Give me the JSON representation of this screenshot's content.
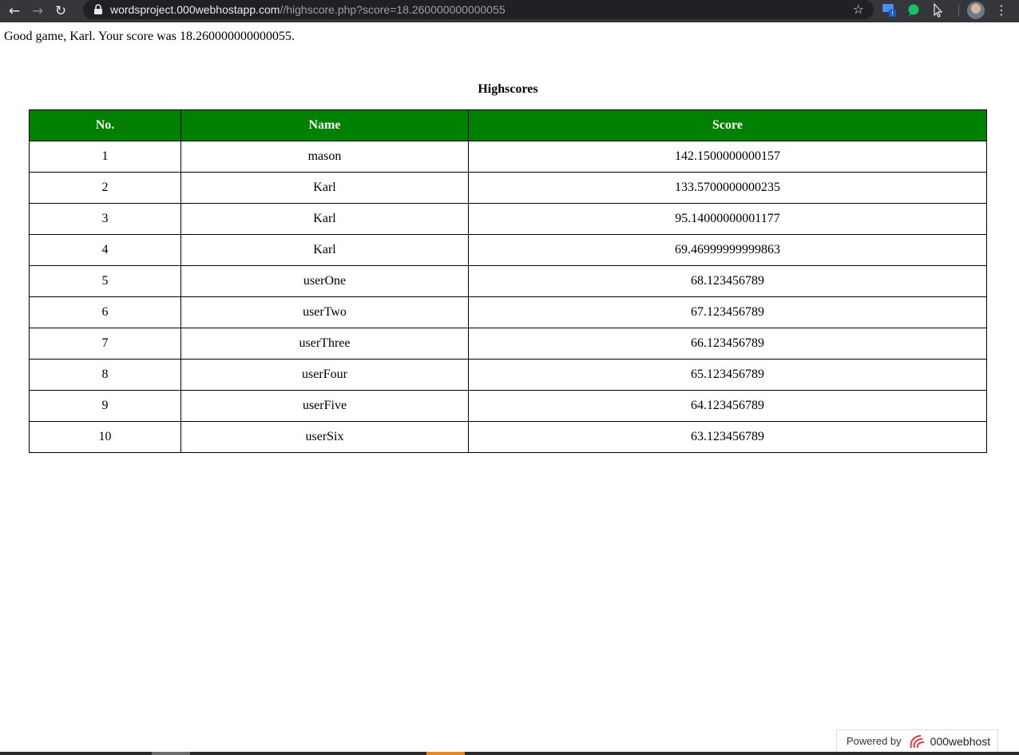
{
  "browser": {
    "url_host": "wordsproject.000webhostapp.com",
    "url_path": "//highscore.php?score=18.260000000000055",
    "icons": [
      "back-arrow-icon",
      "forward-arrow-icon",
      "reload-icon",
      "lock-icon",
      "star-icon",
      "extension-icon",
      "grammarly-icon",
      "cursor-icon",
      "profile-avatar",
      "kebab-menu-icon"
    ],
    "ext_badge": "!"
  },
  "page": {
    "message": "Good game, Karl. Your score was 18.260000000000055.",
    "caption": "Highscores",
    "header_color": "#008000"
  },
  "table": {
    "headers": {
      "rank": "No.",
      "name": "Name",
      "score": "Score"
    },
    "rows": [
      {
        "rank": "1",
        "name": "mason",
        "score": "142.1500000000157"
      },
      {
        "rank": "2",
        "name": "Karl",
        "score": "133.5700000000235"
      },
      {
        "rank": "3",
        "name": "Karl",
        "score": "95.14000000001177"
      },
      {
        "rank": "4",
        "name": "Karl",
        "score": "69.46999999999863"
      },
      {
        "rank": "5",
        "name": "userOne",
        "score": "68.123456789"
      },
      {
        "rank": "6",
        "name": "userTwo",
        "score": "67.123456789"
      },
      {
        "rank": "7",
        "name": "userThree",
        "score": "66.123456789"
      },
      {
        "rank": "8",
        "name": "userFour",
        "score": "65.123456789"
      },
      {
        "rank": "9",
        "name": "userFive",
        "score": "64.123456789"
      },
      {
        "rank": "10",
        "name": "userSix",
        "score": "63.123456789"
      }
    ]
  },
  "footer": {
    "powered_label": "Powered by",
    "brand": "000webhost"
  }
}
